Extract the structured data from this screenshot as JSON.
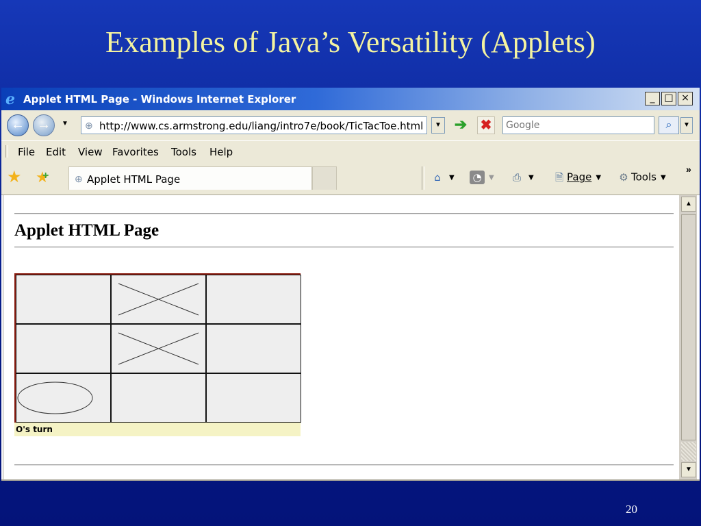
{
  "slide": {
    "title": "Examples of Java’s Versatility (Applets)",
    "page_number": "20"
  },
  "window": {
    "title": "Applet HTML Page - Windows Internet Explorer",
    "controls": {
      "minimize": "_",
      "maximize": "□",
      "close": "×"
    }
  },
  "address_bar": {
    "url": "http://www.cs.armstrong.edu/liang/intro7e/book/TicTacToe.html",
    "search_placeholder": "Google"
  },
  "menu": {
    "items": [
      "File",
      "Edit",
      "View",
      "Favorites",
      "Tools",
      "Help"
    ]
  },
  "tabs": {
    "active_label": "Applet HTML Page"
  },
  "command_bar": {
    "page_label": "Page",
    "tools_label": "Tools",
    "overflow": "»"
  },
  "page": {
    "heading": "Applet HTML Page"
  },
  "tictactoe": {
    "board": [
      [
        "",
        "X",
        ""
      ],
      [
        "",
        "X",
        ""
      ],
      [
        "O",
        "",
        ""
      ]
    ],
    "status": "O's turn"
  },
  "colors": {
    "slide_background": "#0b2596",
    "slide_title": "#f4f3a0",
    "board_border": "#8a1c10",
    "status_bar": "#f5f3c5"
  }
}
